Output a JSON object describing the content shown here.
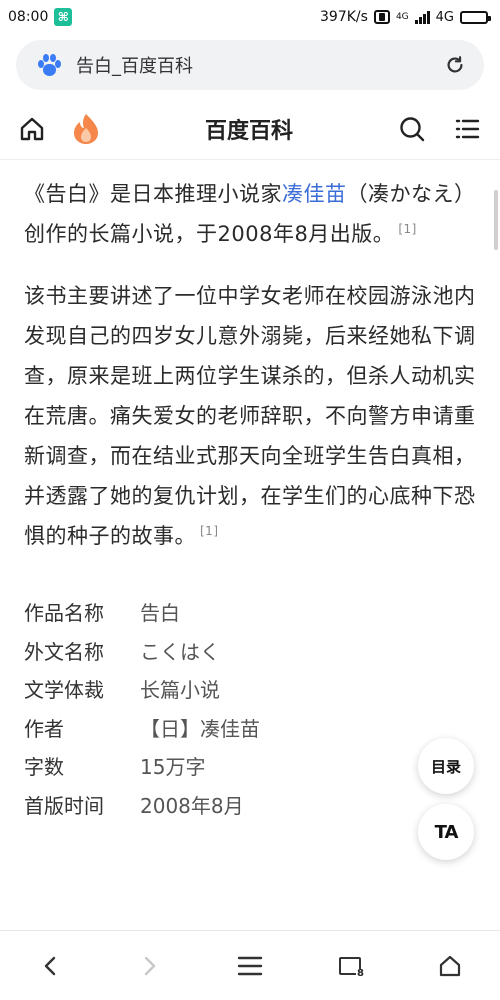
{
  "status_bar": {
    "time": "08:00",
    "speed": "397K/s",
    "network": "4G",
    "wifi_label": "4G"
  },
  "url_bar": {
    "text": "告白_百度百科"
  },
  "nav": {
    "title": "百度百科"
  },
  "article": {
    "p1_before": "《告白》是日本推理小说家",
    "p1_link": "凑佳苗",
    "p1_after": "（凑かなえ）创作的长篇小说，于2008年8月出版。",
    "p1_ref": "[1]",
    "p2": "该书主要讲述了一位中学女老师在校园游泳池内发现自己的四岁女儿意外溺毙，后来经她私下调查，原来是班上两位学生谋杀的，但杀人动机实在荒唐。痛失爱女的老师辞职，不向警方申请重新调查，而在结业式那天向全班学生告白真相，并透露了她的复仇计划，在学生们的心底种下恐惧的种子的故事。",
    "p2_ref": "[1]"
  },
  "infobox": [
    {
      "label": "作品名称",
      "value": "告白"
    },
    {
      "label": "外文名称",
      "value": "こくはく"
    },
    {
      "label": "文学体裁",
      "value": "长篇小说"
    },
    {
      "label": "作者",
      "value": "【日】凑佳苗"
    },
    {
      "label": "字数",
      "value": "15万字"
    },
    {
      "label": "首版时间",
      "value": "2008年8月"
    }
  ],
  "fabs": {
    "toc": "目录",
    "font": "TA"
  },
  "bottom_bar": {
    "tab_count": "8"
  },
  "colors": {
    "link": "#3a6ed6",
    "baidu_blue": "#3a7cf5",
    "flame": "#f5874a"
  }
}
